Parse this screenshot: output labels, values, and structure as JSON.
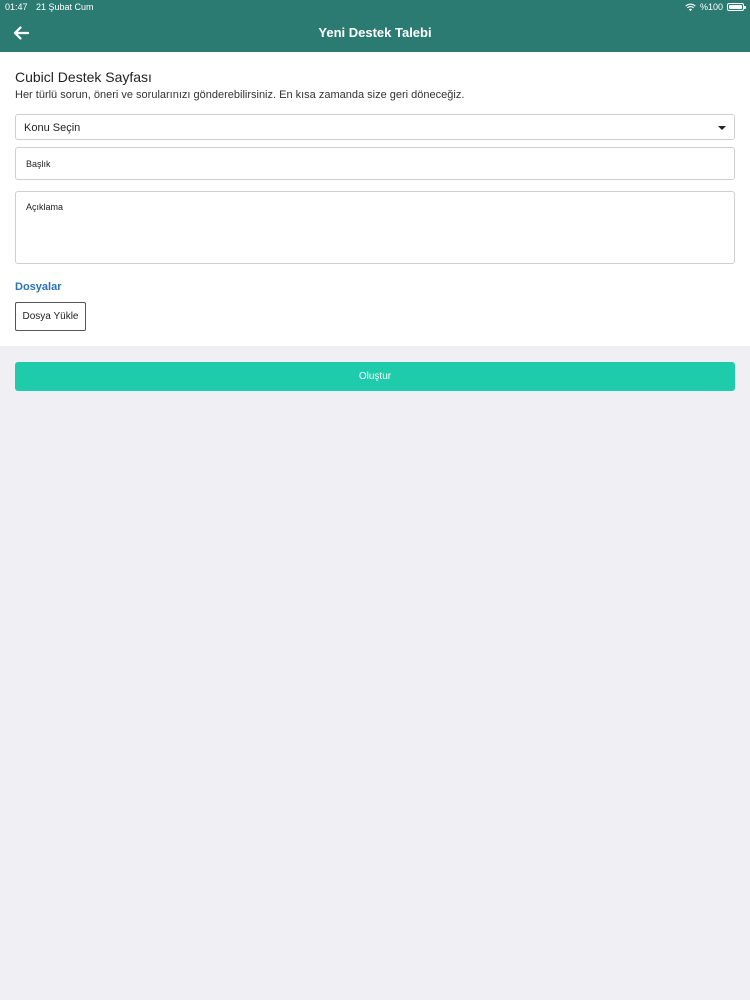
{
  "status_bar": {
    "time": "01:47",
    "date": "21 Şubat Cum",
    "battery": "%100",
    "battery_level": 1.0
  },
  "nav": {
    "title": "Yeni Destek Talebi",
    "back_icon": "arrow-left-icon"
  },
  "form": {
    "title": "Cubicl Destek Sayfası",
    "description": "Her türlü sorun, öneri ve sorularınızı gönderebilirsiniz. En kısa zamanda size geri döneceğiz.",
    "topic_select": {
      "selected": "Konu Seçin"
    },
    "title_input": {
      "placeholder": "Başlık",
      "value": ""
    },
    "description_input": {
      "placeholder": "Açıklama",
      "value": ""
    },
    "files_heading": "Dosyalar",
    "upload_button": "Dosya Yükle"
  },
  "submit_button": "Oluştur",
  "colors": {
    "header": "#2c7b73",
    "accent": "#1ecbaa",
    "link": "#2a72b8",
    "background": "#efeff4"
  }
}
